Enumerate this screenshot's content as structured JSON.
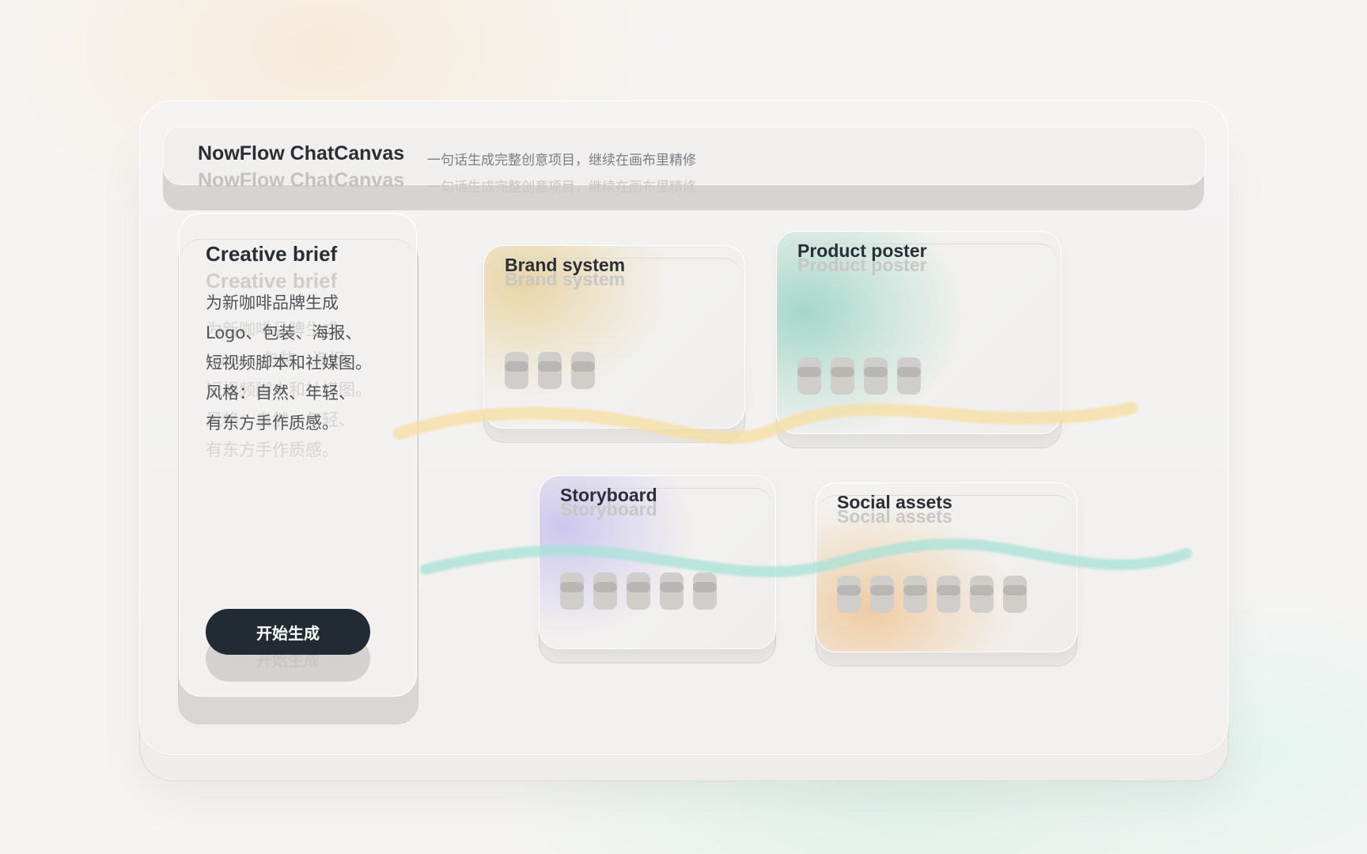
{
  "app": {
    "title": "NowFlow ChatCanvas",
    "subtitle": "一句话生成完整创意项目，继续在画布里精修"
  },
  "brief": {
    "title": "Creative brief",
    "body": "为新咖啡品牌生成\nLogo、包装、海报、\n短视频脚本和社媒图。\n风格：自然、年轻、\n有东方手作质感。",
    "action_label": "开始生成"
  },
  "canvas": {
    "cards": [
      {
        "title": "Brand system",
        "accent": "#e8d3a0",
        "chip_count": 3
      },
      {
        "title": "Product poster",
        "accent": "#9fd6c6",
        "chip_count": 4
      },
      {
        "title": "Storyboard",
        "accent": "#c9c4ee",
        "chip_count": 5
      },
      {
        "title": "Social assets",
        "accent": "#efc99c",
        "chip_count": 6
      }
    ],
    "ribbon_colors": [
      "#f7dfa2",
      "#a8e2d8"
    ]
  },
  "colors": {
    "primary_button": "#222a33",
    "text_dark": "#2a2f36",
    "text_muted": "#7b7e84"
  }
}
